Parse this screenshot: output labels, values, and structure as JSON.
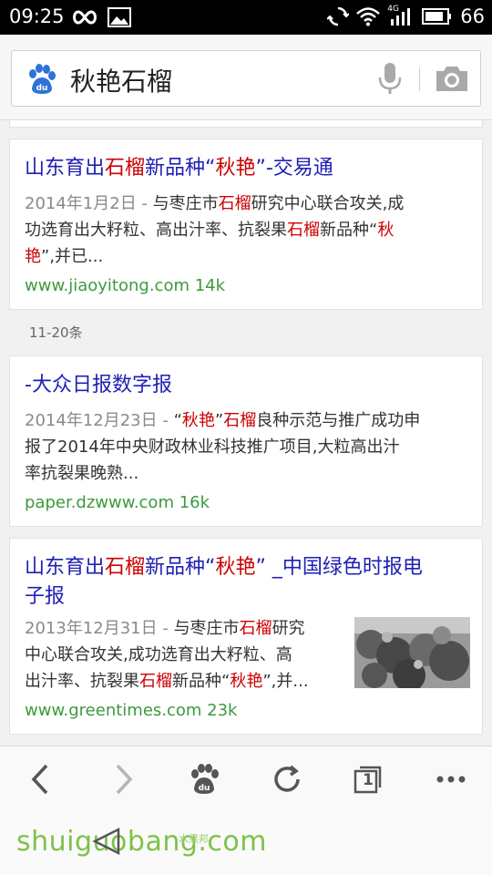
{
  "status_bar": {
    "time": "09:25",
    "battery": "66",
    "network": "4G"
  },
  "search": {
    "query": "秋艳石榴",
    "icons": [
      "baidu-paw-icon",
      "mic-icon",
      "camera-icon"
    ]
  },
  "results": [
    {
      "title_parts": [
        "山东育出",
        "石榴",
        "新品种“",
        "秋艳",
        "”-交易通"
      ],
      "date": "2014年1月2日 - ",
      "abstract_lines": [
        [
          "与枣庄市",
          "石榴",
          "研究中心联合攻关,成"
        ],
        [
          "功选育出大籽粒、高出汁率、抗裂果",
          "石榴",
          "新品种“",
          "秋",
          ""
        ],
        [
          "艳",
          "”,并已..."
        ]
      ],
      "url": "www.jiaoyitong.com 14k"
    },
    {
      "title_parts": [
        "-大众日报数字报"
      ],
      "date": "2014年12月23日 - ",
      "abstract_lines": [
        [
          "“",
          "秋艳",
          "”",
          "石榴",
          "良种示范与推广成功申"
        ],
        [
          "报了2014年中央财政林业科技推广项目,大粒高出汁"
        ],
        [
          "率抗裂果晚熟..."
        ]
      ],
      "url": "paper.dzwww.com 16k"
    },
    {
      "title_parts": [
        "山东育出",
        "石榴",
        "新品种“",
        "秋艳",
        "” _中国绿色时报电",
        "子报"
      ],
      "date": "2013年12月31日 - ",
      "abstract_lines": [
        [
          "与枣庄市",
          "石榴",
          "研究"
        ],
        [
          "中心联合攻关,成功选育出大籽粒、高"
        ],
        [
          "出汁率、抗裂果",
          "石榴",
          "新品种“",
          "秋艳",
          "”,并..."
        ]
      ],
      "url": "www.greentimes.com 23k"
    }
  ],
  "page_marker": "11-20条",
  "bottom_nav": [
    "back-icon",
    "forward-icon",
    "baidu-home-icon",
    "refresh-icon",
    "tabs-icon",
    "more-icon"
  ],
  "tabs_count": "1",
  "watermark": {
    "main": "shuiguobang.com",
    "small": "水果邦"
  },
  "colors": {
    "link": "#1f1fb4",
    "highlight": "#cc0000",
    "url": "#3c9a3c",
    "baidu_blue": "#2d73d8"
  }
}
